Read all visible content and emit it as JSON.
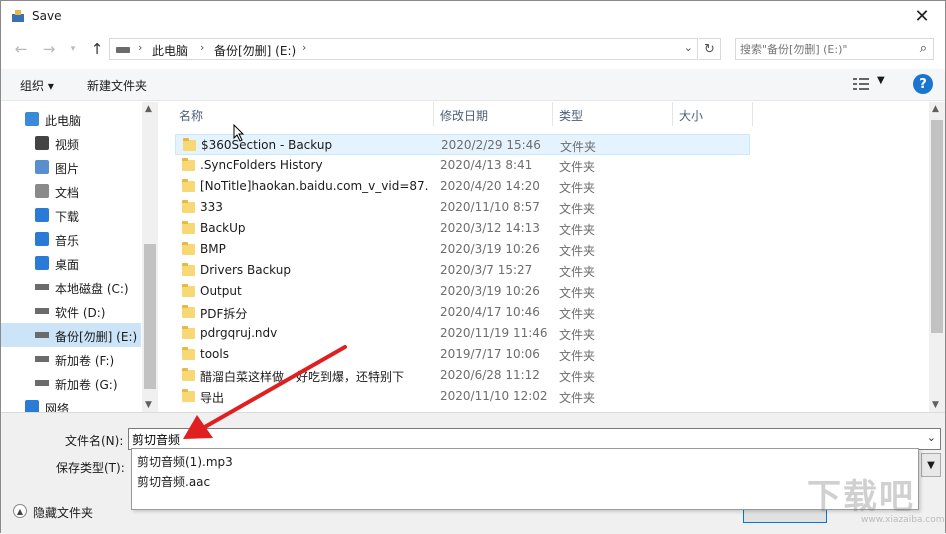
{
  "window": {
    "title": "Save"
  },
  "nav": {
    "breadcrumbs": [
      "此电脑",
      "备份[勿删] (E:)"
    ],
    "search_placeholder": "搜索\"备份[勿删] (E:)\""
  },
  "toolbar": {
    "organize": "组织 ▾",
    "new_folder": "新建文件夹",
    "help": "?"
  },
  "sidebar": {
    "items": [
      {
        "label": "此电脑",
        "icon": "computer-icon"
      },
      {
        "label": "视频",
        "icon": "video-icon"
      },
      {
        "label": "图片",
        "icon": "picture-icon"
      },
      {
        "label": "文档",
        "icon": "document-icon"
      },
      {
        "label": "下载",
        "icon": "download-icon"
      },
      {
        "label": "音乐",
        "icon": "music-icon"
      },
      {
        "label": "桌面",
        "icon": "desktop-icon"
      },
      {
        "label": "本地磁盘 (C:)",
        "icon": "drive-icon"
      },
      {
        "label": "软件 (D:)",
        "icon": "drive-icon"
      },
      {
        "label": "备份[勿删] (E:)",
        "icon": "drive-icon",
        "selected": true
      },
      {
        "label": "新加卷 (F:)",
        "icon": "drive-icon"
      },
      {
        "label": "新加卷 (G:)",
        "icon": "drive-icon"
      },
      {
        "label": "网络",
        "icon": "network-icon"
      }
    ]
  },
  "columns": {
    "name": "名称",
    "date": "修改日期",
    "type": "类型",
    "size": "大小"
  },
  "files": [
    {
      "name": "$360Section - Backup",
      "date": "2020/2/29 15:46",
      "type": "文件夹"
    },
    {
      "name": ".SyncFolders History",
      "date": "2020/4/13 8:41",
      "type": "文件夹"
    },
    {
      "name": "[NoTitle]haokan.baidu.com_v_vid=87...",
      "date": "2020/4/20 14:20",
      "type": "文件夹"
    },
    {
      "name": "333",
      "date": "2020/11/10 8:57",
      "type": "文件夹"
    },
    {
      "name": "BackUp",
      "date": "2020/3/12 14:13",
      "type": "文件夹"
    },
    {
      "name": "BMP",
      "date": "2020/3/19 10:26",
      "type": "文件夹"
    },
    {
      "name": "Drivers Backup",
      "date": "2020/3/7 15:27",
      "type": "文件夹"
    },
    {
      "name": "Output",
      "date": "2020/3/19 10:26",
      "type": "文件夹"
    },
    {
      "name": "PDF拆分",
      "date": "2020/4/17 10:46",
      "type": "文件夹"
    },
    {
      "name": "pdrgqruj.ndv",
      "date": "2020/11/19 11:46",
      "type": "文件夹"
    },
    {
      "name": "tools",
      "date": "2019/7/17 10:06",
      "type": "文件夹"
    },
    {
      "name": "醋溜白菜这样做，好吃到爆，还特别下",
      "date": "2020/6/28 11:12",
      "type": "文件夹"
    },
    {
      "name": "导出",
      "date": "2020/11/10 12:02",
      "type": "文件夹"
    }
  ],
  "form": {
    "filename_label": "文件名(N):",
    "filename_value": "剪切音频",
    "filetype_label": "保存类型(T):",
    "suggestions": [
      "剪切音频(1).mp3",
      "剪切音频.aac"
    ],
    "hide_folders": "隐藏文件夹"
  },
  "colors": {
    "accent": "#0078d7",
    "selection": "#cce4f7",
    "hover": "#e5f3ff",
    "annotation": "#e02020"
  },
  "watermark": {
    "text": "下载吧",
    "url": "www.xiazaiba.com"
  }
}
